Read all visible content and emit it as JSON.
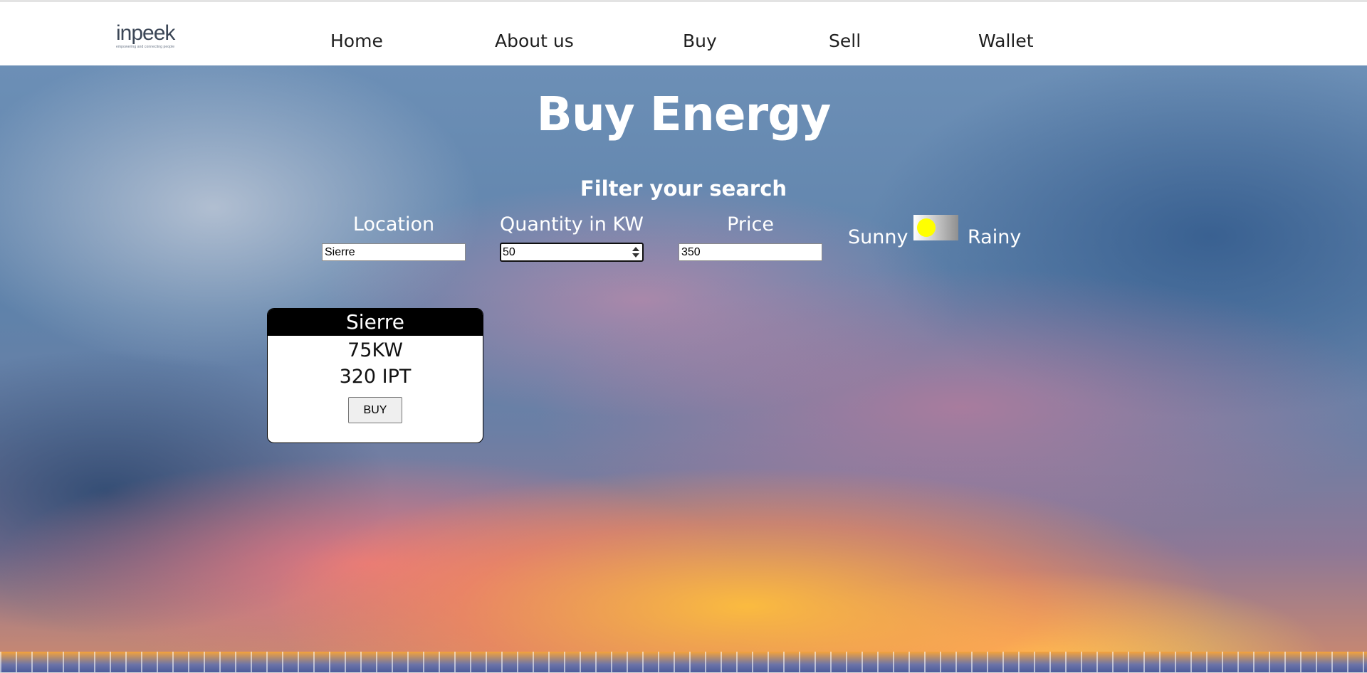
{
  "logo": {
    "text": "inpeek",
    "tagline": "empowering and connecting people"
  },
  "nav": {
    "items": [
      {
        "label": "Home"
      },
      {
        "label": "About us"
      },
      {
        "label": "Buy"
      },
      {
        "label": "Sell"
      },
      {
        "label": "Wallet"
      }
    ]
  },
  "hero": {
    "title": "Buy Energy",
    "filter_title": "Filter your search"
  },
  "filters": {
    "location": {
      "label": "Location",
      "value": "Sierre"
    },
    "quantity": {
      "label": "Quantity in KW",
      "value": "50"
    },
    "price": {
      "label": "Price",
      "value": "350"
    },
    "weather": {
      "left_label": "Sunny",
      "right_label": "Rainy",
      "state": "Sunny"
    }
  },
  "listings": [
    {
      "location": "Sierre",
      "quantity": "75KW",
      "price": "320 IPT",
      "button_label": "BUY"
    }
  ],
  "colors": {
    "toggle_knob": "#ffff00",
    "card_header": "#000000",
    "text_on_hero": "#ffffff"
  }
}
